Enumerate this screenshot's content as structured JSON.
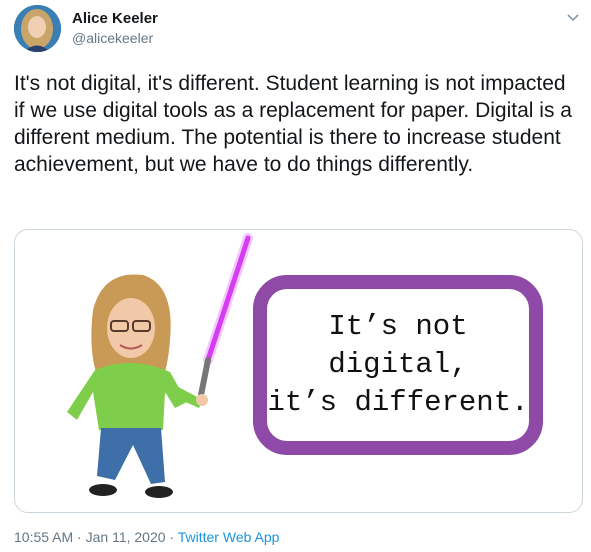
{
  "author": {
    "name": "Alice Keeler",
    "handle": "@alicekeeler"
  },
  "tweet": {
    "text": "It's not digital, it's different. Student learning is not impacted if we use digital tools as a replacement for paper. Digital is a different medium. The potential is there to increase student achievement, but we have to do things differently."
  },
  "media": {
    "sign_text": "It’s not\ndigital,\nit’s different."
  },
  "meta": {
    "time": "10:55 AM",
    "sep1": " · ",
    "date": "Jan 11, 2020",
    "sep2": " · ",
    "app": "Twitter Web App"
  },
  "colors": {
    "link": "#1b95e0",
    "secondary_text": "#657786",
    "sign_border": "#8e4aa6",
    "lightsaber": "#d63df2"
  }
}
